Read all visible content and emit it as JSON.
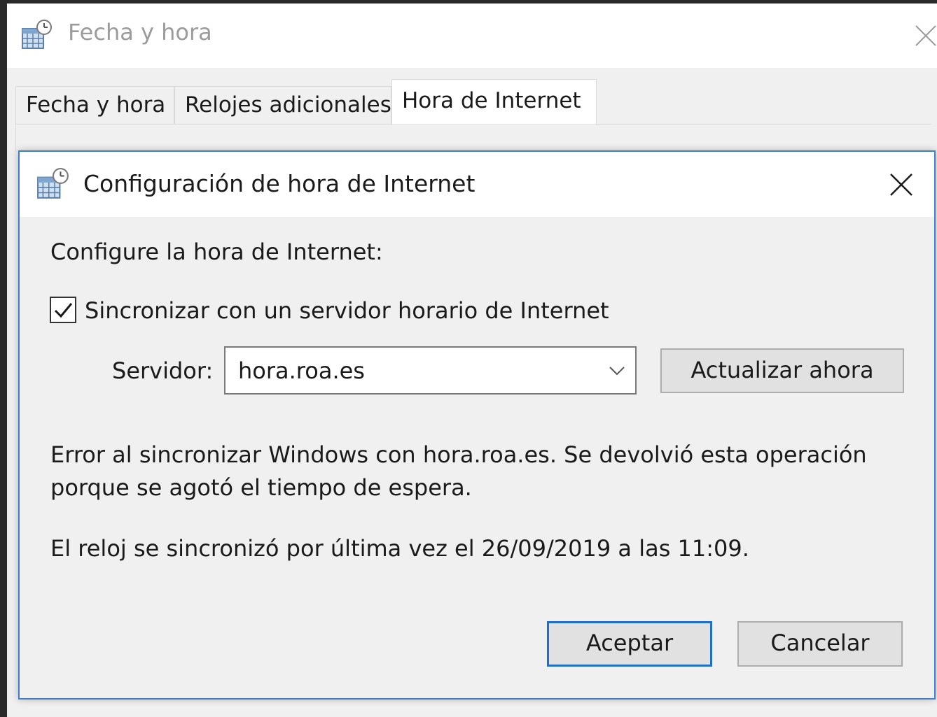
{
  "outer_window": {
    "title": "Fecha y hora",
    "icon": "date-time-settings-icon",
    "close_icon": "close-icon"
  },
  "tabs": [
    {
      "label": "Fecha y hora",
      "selected": false
    },
    {
      "label": "Relojes adicionales",
      "selected": false
    },
    {
      "label": "Hora de Internet",
      "selected": true
    }
  ],
  "dialog": {
    "title": "Configuración de hora de Internet",
    "icon": "date-time-settings-icon",
    "close_icon": "close-icon",
    "heading": "Configure la hora de Internet:",
    "sync_checkbox": {
      "label": "Sincronizar con un servidor horario de Internet",
      "checked": true
    },
    "server": {
      "label": "Servidor:",
      "value": "hora.roa.es",
      "dropdown_icon": "chevron-down-icon"
    },
    "update_button": "Actualizar ahora",
    "error_message": "Error al sincronizar Windows con hora.roa.es.  Se devolvió esta operación porque se agotó el tiempo de espera.",
    "last_sync": "El reloj se sincronizó por última vez el 26/09/2019 a las 11:09.",
    "ok_button": "Aceptar",
    "cancel_button": "Cancelar"
  },
  "colors": {
    "accent_border": "#3c7fd1",
    "default_button_border": "#1f6ec7",
    "dialog_background": "#f0f0f0",
    "titlebar_background": "#ffffff"
  }
}
